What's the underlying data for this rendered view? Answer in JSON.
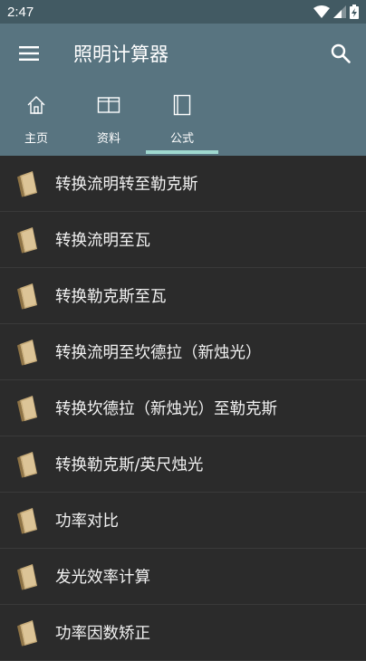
{
  "status_bar": {
    "time": "2:47",
    "icons": [
      "wifi-icon",
      "signal-icon",
      "battery-charging-icon"
    ]
  },
  "app_bar": {
    "title": "照明计算器",
    "menu_icon": "hamburger-menu-icon",
    "search_icon": "search-icon"
  },
  "tabs": [
    {
      "label": "主页",
      "icon": "home-icon",
      "selected": false
    },
    {
      "label": "资料",
      "icon": "book-open-icon",
      "selected": false
    },
    {
      "label": "公式",
      "icon": "book-icon",
      "selected": true
    }
  ],
  "colors": {
    "app_bar": "#587480",
    "status_bar": "#425a63",
    "background": "#2b2b2b",
    "tab_indicator": "#9fd8cf",
    "book": "#c9ad7a"
  },
  "items": [
    {
      "label": "转换流明转至勒克斯"
    },
    {
      "label": "转换流明至瓦"
    },
    {
      "label": "转换勒克斯至瓦"
    },
    {
      "label": "转换流明至坎德拉（新烛光）"
    },
    {
      "label": "转换坎德拉（新烛光）至勒克斯"
    },
    {
      "label": "转换勒克斯/英尺烛光"
    },
    {
      "label": "功率对比"
    },
    {
      "label": "发光效率计算"
    },
    {
      "label": "功率因数矫正"
    }
  ]
}
